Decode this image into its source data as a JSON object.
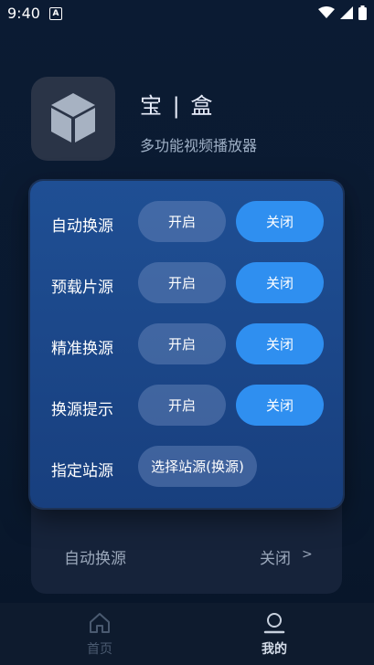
{
  "status": {
    "time": "9:40",
    "notif_letter": "A"
  },
  "app": {
    "title": "宝 | 盒",
    "subtitle": "多功能视频播放器"
  },
  "background_row": {
    "label": "自动换源",
    "value": "关闭",
    "chevron": ">"
  },
  "dialog": {
    "rows": [
      {
        "label": "自动换源",
        "on": "开启",
        "off": "关闭"
      },
      {
        "label": "预载片源",
        "on": "开启",
        "off": "关闭"
      },
      {
        "label": "精准换源",
        "on": "开启",
        "off": "关闭"
      },
      {
        "label": "换源提示",
        "on": "开启",
        "off": "关闭"
      }
    ],
    "source_row": {
      "label": "指定站源",
      "button": "选择站源(换源)"
    }
  },
  "tabs": [
    {
      "label": "首页",
      "icon": "home-icon"
    },
    {
      "label": "我的",
      "icon": "profile-icon"
    }
  ],
  "colors": {
    "accent": "#2f8ff0",
    "dialog_bg": "#1f4f94"
  }
}
